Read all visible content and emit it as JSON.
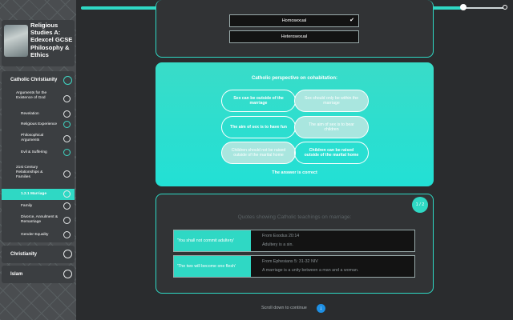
{
  "progress": {
    "value": 0.9
  },
  "sidebar": {
    "course_title": "Religious Studies A: Edexcel GCSE Philosophy & Ethics",
    "sections": [
      {
        "label": "Catholic Christianity"
      },
      {
        "label": "Christianity"
      },
      {
        "label": "Islam"
      }
    ],
    "items": [
      {
        "label": "Arguments for the Existence of God"
      },
      {
        "label": "Revelation"
      },
      {
        "label": "Religious Experience"
      },
      {
        "label": "Philosophical Arguments"
      },
      {
        "label": "Evil & Suffering"
      },
      {
        "label": "21st Century Relationships & Families"
      },
      {
        "label": "1.2.1 Marriage"
      },
      {
        "label": "Family"
      },
      {
        "label": "Divorce, Annulment & Remarriage"
      },
      {
        "label": "Gender Equality"
      }
    ]
  },
  "options": {
    "homosexual": "Homosexual",
    "heterosexual": "Heterosexual"
  },
  "cohabitation": {
    "title": "Catholic perspective on cohabitation:",
    "pairs": [
      {
        "left": "Sex can be outside of the marriage",
        "right": "Sex should only be within the marriage"
      },
      {
        "left": "The aim of sex is to have fun",
        "right": "The aim of sex is to bear children"
      },
      {
        "left": "Children should not be raised outside of the marital home",
        "right": "Children can be raised outside of the marital home"
      }
    ],
    "answer": "The answer is correct"
  },
  "quotes": {
    "page": "1 / 2",
    "title": "Quotes showing Catholic teachings on marriage:",
    "items": [
      {
        "quote": "'You shall not commit adultery'",
        "source": "From Exodus 20:14",
        "explanation": "Adultery is a sin."
      },
      {
        "quote": "'The two will become one flesh'",
        "source": "From Ephesians 5: 31-32 NIV",
        "explanation": "A marriage is a unity between a man and a woman."
      }
    ]
  },
  "footer": {
    "scroll_text": "Scroll down to continue"
  },
  "colors": {
    "accent": "#2fd8c4",
    "background": "#2a2c2e",
    "panel": "#313335",
    "scroll_button": "#1e90e5"
  }
}
